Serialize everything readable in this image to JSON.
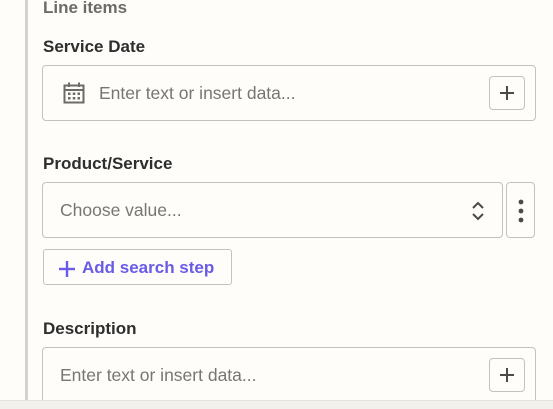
{
  "section": {
    "title": "Line items"
  },
  "service_date": {
    "label": "Service Date",
    "placeholder": "Enter text or insert data..."
  },
  "product_service": {
    "label": "Product/Service",
    "placeholder": "Choose value..."
  },
  "add_search_step": {
    "label": "Add search step"
  },
  "description": {
    "label": "Description",
    "placeholder": "Enter text or insert data..."
  },
  "colors": {
    "accent": "#695be8",
    "border": "#c5c2ba",
    "background": "#fffdf9",
    "placeholder": "#767672"
  },
  "icons": {
    "calendar": "calendar-icon",
    "plus": "plus-icon",
    "select": "chevron-up-down-icon",
    "more": "more-vertical-icon"
  }
}
